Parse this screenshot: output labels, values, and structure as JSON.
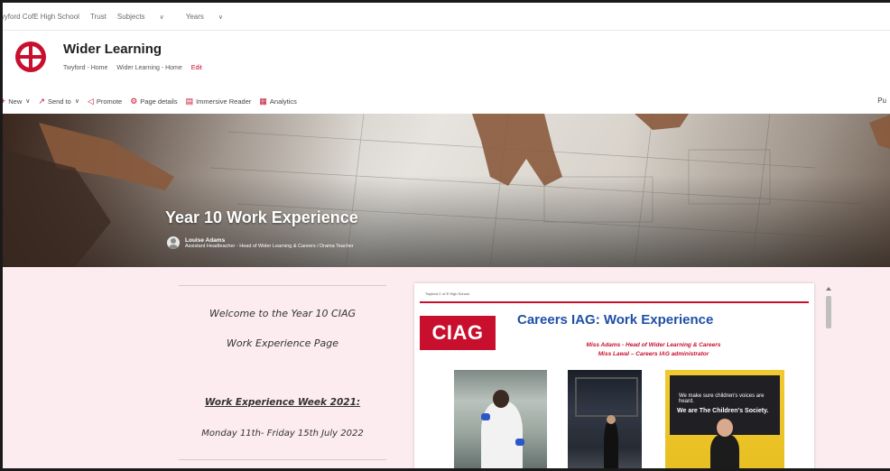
{
  "topnav": {
    "site": "wyford CofE High School",
    "links": [
      "Trust",
      "Subjects",
      "Years"
    ]
  },
  "header": {
    "title": "Wider Learning",
    "breadcrumbs": [
      "Twyford - Home",
      "Wider Learning - Home"
    ],
    "edit": "Edit"
  },
  "commandbar": {
    "items": [
      "New",
      "Send to",
      "Promote",
      "Page details",
      "Immersive Reader",
      "Analytics"
    ],
    "right": "Pu"
  },
  "hero": {
    "title": "Year 10 Work Experience",
    "author_name": "Louise Adams",
    "author_role": "Assistant Headteacher - Head of Wider Learning & Careers / Drama Teacher"
  },
  "left_card": {
    "line1": "Welcome to the Year 10 CIAG",
    "line2": "Work Experience Page",
    "line3": "Work Experience Week 2021:",
    "line4": "Monday 11th- Friday 15th July 2022"
  },
  "doc": {
    "school": "Twyford C of E High School",
    "badge": "CIAG",
    "heading": "Careers IAG: Work Experience",
    "sub1": "Miss Adams - Head of Wider Learning & Careers",
    "sub2": "Miss Lawal – Careers IAG administrator",
    "photo3_line1": "We make sure children's voices are heard.",
    "photo3_line2": "We are The Children's Society."
  },
  "colors": {
    "brand": "#c8102e",
    "heading_blue": "#1f4fa6",
    "page_bg": "#fcecef"
  }
}
